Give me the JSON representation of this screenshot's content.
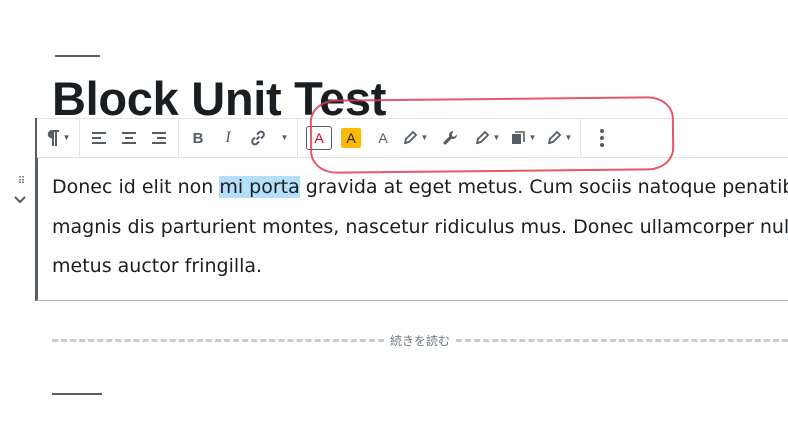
{
  "post": {
    "title": "Block Unit Test",
    "paragraph": {
      "before": "Donec id elit non ",
      "selected": "mi porta",
      "line1_after": " gravida at eget metus. Cum sociis natoque penatibus et",
      "line2": "magnis dis parturient montes, nascetur ridiculus mus. Donec ullamcorper nulla non",
      "line3": "metus auctor fringilla."
    },
    "read_more_label": "続きを読む"
  },
  "toolbar": {
    "paragraph_icon": "pilcrow-icon",
    "alignment": [
      "align-left-icon",
      "align-center-icon",
      "align-right-icon"
    ],
    "formatting": [
      "bold-icon",
      "italic-icon",
      "link-icon"
    ],
    "text_color_label": "A",
    "highlight_label": "A",
    "font_size_label": "A",
    "colors": {
      "text_color": "#d0021b",
      "highlight": "#fcb900",
      "selection": "#b4dff6",
      "annotation": "#e23b4e"
    }
  }
}
